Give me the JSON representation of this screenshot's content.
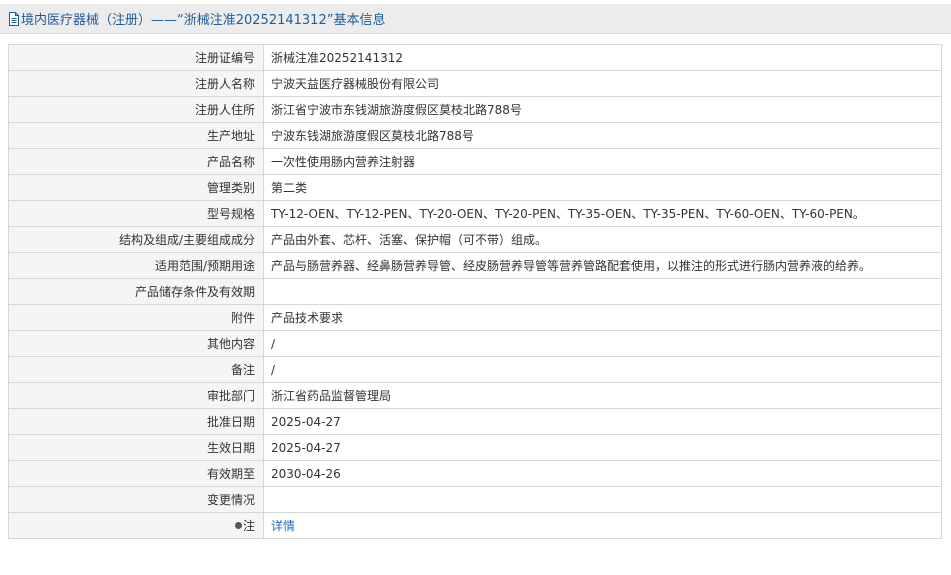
{
  "title": "境内医疗器械（注册）——“浙械注准20252141312”基本信息",
  "rows": [
    {
      "label": "注册证编号",
      "value": "浙械注准20252141312"
    },
    {
      "label": "注册人名称",
      "value": "宁波天益医疗器械股份有限公司"
    },
    {
      "label": "注册人住所",
      "value": "浙江省宁波市东钱湖旅游度假区莫枝北路788号"
    },
    {
      "label": "生产地址",
      "value": "宁波东钱湖旅游度假区莫枝北路788号"
    },
    {
      "label": "产品名称",
      "value": "一次性使用肠内营养注射器"
    },
    {
      "label": "管理类别",
      "value": "第二类"
    },
    {
      "label": "型号规格",
      "value": "TY-12-OEN、TY-12-PEN、TY-20-OEN、TY-20-PEN、TY-35-OEN、TY-35-PEN、TY-60-OEN、TY-60-PEN。"
    },
    {
      "label": "结构及组成/主要组成成分",
      "value": "产品由外套、芯杆、活塞、保护帽（可不带）组成。"
    },
    {
      "label": "适用范围/预期用途",
      "value": "产品与肠营养器、经鼻肠营养导管、经皮肠营养导管等营养管路配套使用，以推注的形式进行肠内营养液的给养。"
    },
    {
      "label": "产品储存条件及有效期",
      "value": ""
    },
    {
      "label": "附件",
      "value": "产品技术要求"
    },
    {
      "label": "其他内容",
      "value": "/"
    },
    {
      "label": "备注",
      "value": "/"
    },
    {
      "label": "审批部门",
      "value": "浙江省药品监督管理局"
    },
    {
      "label": "批准日期",
      "value": "2025-04-27"
    },
    {
      "label": "生效日期",
      "value": "2025-04-27"
    },
    {
      "label": "有效期至",
      "value": "2030-04-26"
    },
    {
      "label": "变更情况",
      "value": ""
    },
    {
      "label": "注",
      "value": "详情"
    }
  ],
  "colors": {
    "title_text": "#1f5d99",
    "title_background": "#ececec",
    "label_background": "#f5f5f5",
    "border": "#d7d7d7",
    "link": "#1a6bc0"
  },
  "icons": {
    "title": "document-icon",
    "note": "lightbulb-icon"
  }
}
